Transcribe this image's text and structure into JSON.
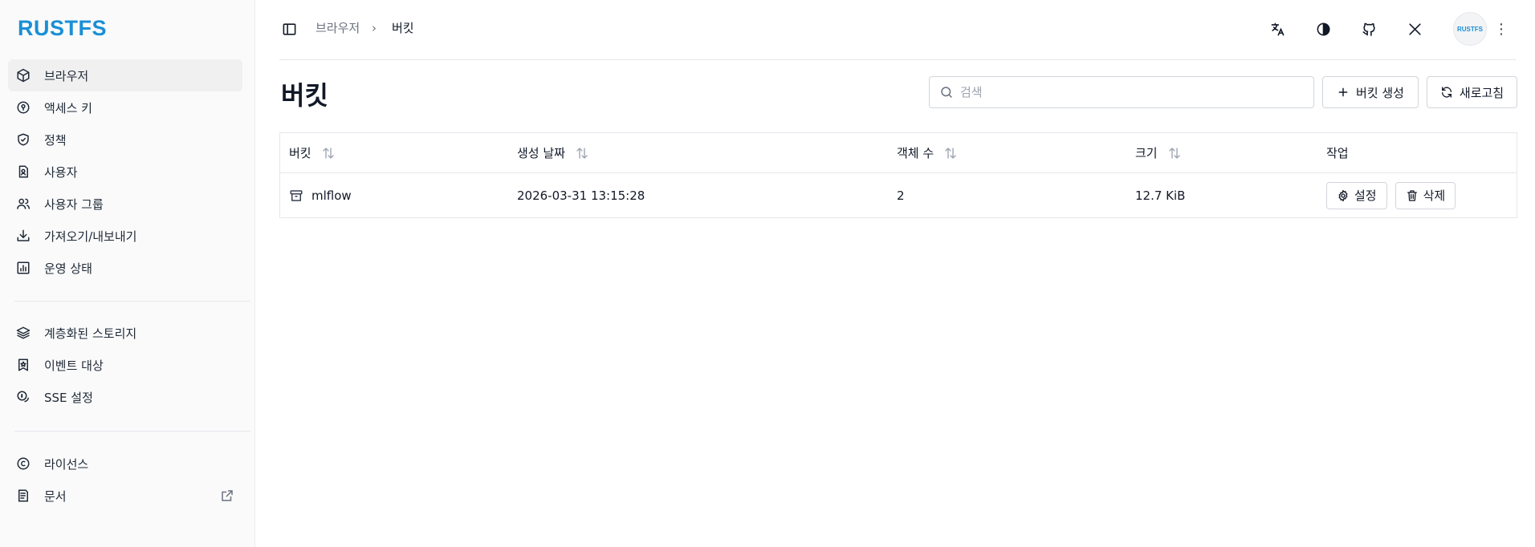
{
  "app": {
    "logo": "RUSTFS"
  },
  "sidebar": {
    "items": [
      {
        "label": "브라우저",
        "icon": "cube-icon",
        "active": true
      },
      {
        "label": "액세스 키",
        "icon": "key-circle-icon"
      },
      {
        "label": "정책",
        "icon": "shield-check-icon"
      },
      {
        "label": "사용자",
        "icon": "user-badge-icon"
      },
      {
        "label": "사용자 그룹",
        "icon": "users-icon"
      },
      {
        "label": "가져오기/내보내기",
        "icon": "download-tray-icon"
      },
      {
        "label": "운영 상태",
        "icon": "bar-chart-icon"
      }
    ],
    "items2": [
      {
        "label": "계층화된 스토리지",
        "icon": "layers-icon"
      },
      {
        "label": "이벤트 대상",
        "icon": "bookmark-star-icon"
      },
      {
        "label": "SSE 설정",
        "icon": "coins-icon"
      }
    ],
    "items3": [
      {
        "label": "라이선스",
        "icon": "copyright-icon"
      },
      {
        "label": "문서",
        "icon": "document-icon"
      }
    ]
  },
  "breadcrumb": {
    "parent": "브라우저",
    "separator": "›",
    "current": "버킷"
  },
  "topbar": {
    "avatar_text": "RUSTFS",
    "more": "⋮"
  },
  "page": {
    "title": "버킷",
    "search_placeholder": "검색",
    "create_label": "버킷 생성",
    "refresh_label": "새로고침"
  },
  "table": {
    "headers": [
      "버킷",
      "생성 날짜",
      "객체 수",
      "크기",
      "작업"
    ],
    "rows": [
      {
        "name": "mlflow",
        "created": "2026-03-31 13:15:28",
        "objects": "2",
        "size": "12.7 KiB"
      }
    ],
    "settings_label": "설정",
    "delete_label": "삭제"
  },
  "colors": {
    "brand": "#1a8fd6",
    "sidebar_bg": "#fafafa",
    "active_bg": "#f0f0f0",
    "border": "#e5e7eb"
  }
}
